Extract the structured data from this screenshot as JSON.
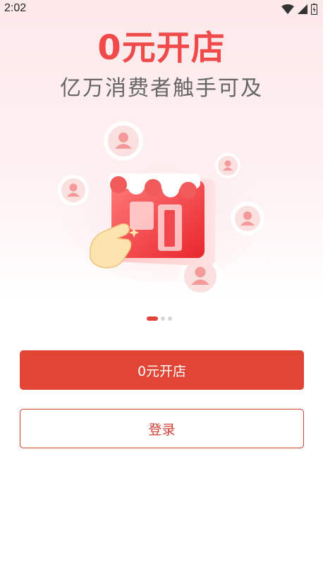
{
  "status": {
    "time": "2:02",
    "icons": [
      "wifi-icon",
      "signal-icon",
      "battery-icon"
    ]
  },
  "hero": {
    "title": "0元开店",
    "subtitle": "亿万消费者触手可及",
    "image": "open-store-illustration"
  },
  "carousel": {
    "pages": 3,
    "active_index": 0
  },
  "actions": {
    "open_store_label": "0元开店",
    "login_label": "登录"
  },
  "colors": {
    "accent": "#e04535",
    "title": "#f04a4a",
    "subtitle": "#666666",
    "background_top": "#fde8ea"
  }
}
